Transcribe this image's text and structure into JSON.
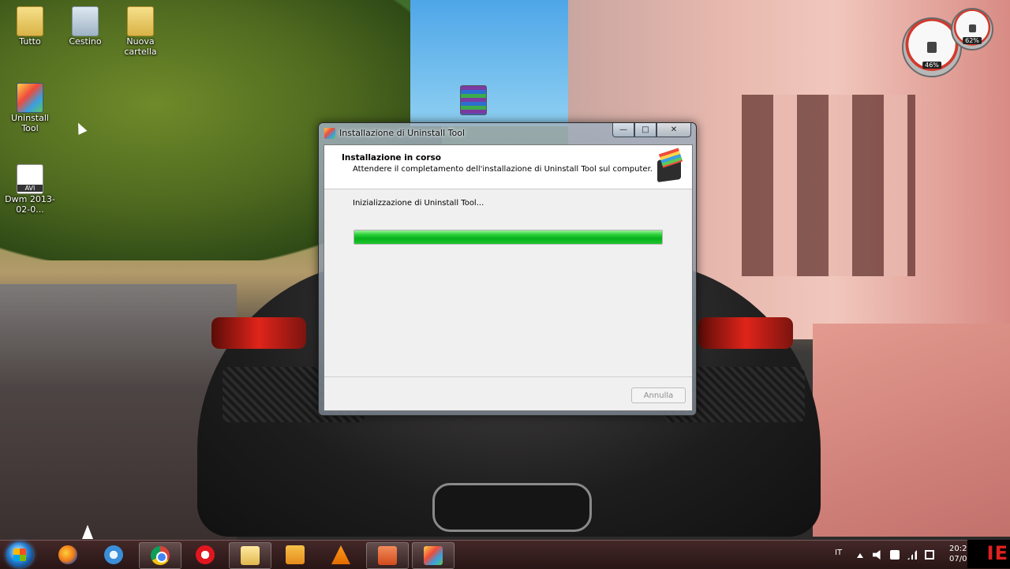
{
  "desktop": {
    "icons": [
      {
        "label": "Tutto",
        "icon": "folder-icon"
      },
      {
        "label": "Cestino",
        "icon": "recycle-bin-icon"
      },
      {
        "label": "Nuova cartella",
        "icon": "folder-icon"
      },
      {
        "label": "Uninstall Tool",
        "icon": "uninstall-tool-icon"
      },
      {
        "label": "Dwm 2013-02-0...",
        "icon": "avi-file-icon"
      },
      {
        "label": "",
        "icon": "rar-archive-icon"
      }
    ],
    "gadgets": {
      "cpu_percent": "46%",
      "memory_percent": "62%"
    }
  },
  "dialog": {
    "title": "Installazione di Uninstall Tool",
    "header_title": "Installazione in corso",
    "header_subtitle": "Attendere il completamento dell'installazione di Uninstall Tool sul computer.",
    "status": "Inizializzazione di Uninstall Tool...",
    "progress_fraction": 1.0,
    "cancel_label": "Annulla",
    "window_buttons": {
      "minimize": "—",
      "maximize": "□",
      "close": "✕"
    }
  },
  "taskbar": {
    "apps": [
      {
        "name": "firefox-icon",
        "pinned": false
      },
      {
        "name": "internet-explorer-icon",
        "pinned": false
      },
      {
        "name": "chrome-icon",
        "pinned": true
      },
      {
        "name": "opera-icon",
        "pinned": false
      },
      {
        "name": "explorer-icon",
        "pinned": true
      },
      {
        "name": "media-player-icon",
        "pinned": false
      },
      {
        "name": "vlc-icon",
        "pinned": false
      },
      {
        "name": "powerpoint-icon",
        "pinned": true
      },
      {
        "name": "uninstall-tool-icon",
        "pinned": true
      }
    ],
    "language": "IT",
    "clock_time": "20:2",
    "clock_date": "07/0"
  },
  "overlay_text": "IE"
}
